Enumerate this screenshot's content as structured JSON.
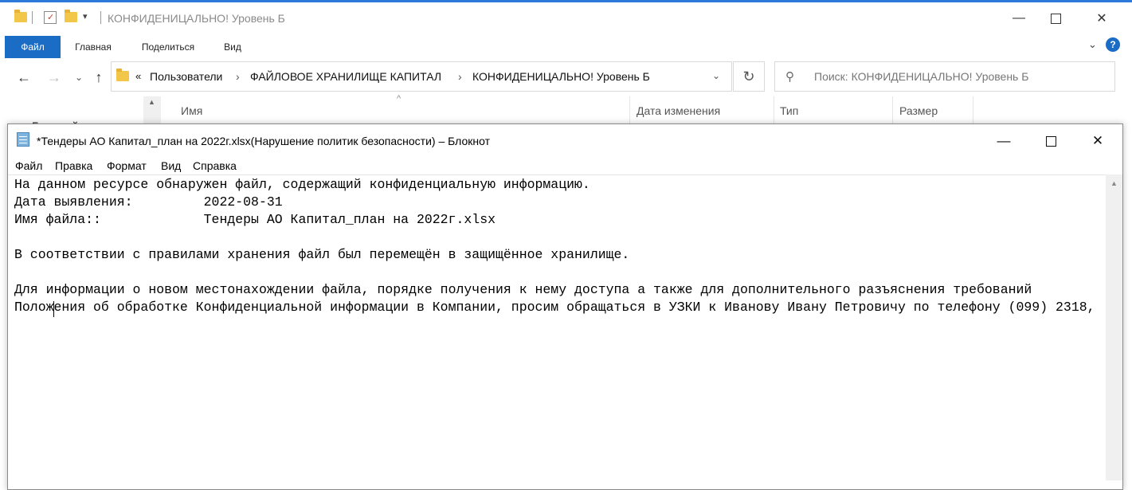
{
  "explorer": {
    "title": "КОНФИДЕНИЦАЛЬНО! Уровень Б",
    "ribbon_tabs": [
      "Файл",
      "Главная",
      "Поделиться",
      "Вид"
    ],
    "breadcrumbs": [
      "Пользователи",
      "ФАЙЛОВОЕ ХРАНИЛИЩЕ КАПИТАЛ",
      "КОНФИДЕНИЦАЛЬНО! Уровень Б"
    ],
    "search_placeholder": "Поиск: КОНФИДЕНИЦАЛЬНО! Уровень Б",
    "columns": [
      "Имя",
      "Дата изменения",
      "Тип",
      "Размер"
    ],
    "sidebar_fragment": "Быстрый доступ",
    "accent_color": "#1a6cc4"
  },
  "notepad": {
    "title": "*Тендеры АО Капитал_план на 2022г.xlsx(Нарушение политик безопасности) – Блокнот",
    "menu": [
      "Файл",
      "Правка",
      "Формат",
      "Вид",
      "Справка"
    ],
    "lines": [
      "На данном ресурсе обнаружен файл, содержащий конфиденциальную информацию.",
      "Дата выявления:         2022-08-31",
      "Имя файла::             Тендеры АО Капитал_план на 2022г.xlsx",
      "",
      "В соответствии с правилами хранения файл был перемещён в защищённое хранилище.",
      "",
      "Для информации о новом местонахождении файла, порядке получения к нему доступа а также для дополнительного разъяснения требований",
      "Положения об обработке Конфиденциальной информации в Компании, просим обращаться в УЗКИ к Иванову Ивану Петровичу по телефону (099) 2318,"
    ]
  }
}
